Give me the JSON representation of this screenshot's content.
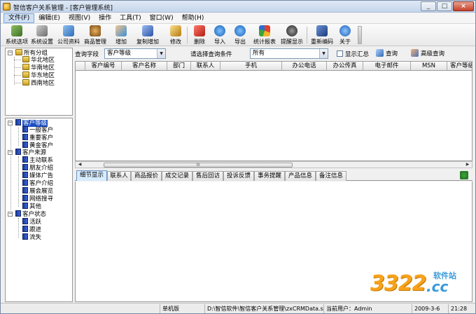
{
  "window": {
    "title": "智信客户关系管理 - [客户管理系统]",
    "controls": [
      "_",
      "□",
      "×"
    ]
  },
  "menu": [
    "文件(F)",
    "编辑(E)",
    "视图(V)",
    "操作",
    "工具(T)",
    "窗口(W)",
    "帮助(H)"
  ],
  "toolbar": [
    {
      "label": "系统选项",
      "icon": "settings-wrench-icon",
      "color": "#5a8a3c"
    },
    {
      "label": "系统设置",
      "icon": "tools-icon",
      "color": "#7a7a7a"
    },
    {
      "label": "公司资料",
      "icon": "company-icon",
      "color": "#3f7fc6"
    },
    {
      "label": "商品管理",
      "icon": "product-icon",
      "color": "#9a6a2a"
    },
    {
      "label": "增加",
      "icon": "add-user-icon",
      "color": "#3b8ed8"
    },
    {
      "label": "复制增加",
      "icon": "copy-add-icon",
      "color": "#3667b8"
    },
    {
      "label": "修改",
      "icon": "edit-icon",
      "color": "#c58a20"
    },
    {
      "label": "删除",
      "icon": "delete-icon",
      "color": "#d0302a"
    },
    {
      "label": "导入",
      "icon": "import-icon",
      "color": "#1f7bd8"
    },
    {
      "label": "导出",
      "icon": "export-icon",
      "color": "#1f7bd8"
    },
    {
      "label": "统计报表",
      "icon": "chart-icon",
      "color": "#d44a2a"
    },
    {
      "label": "提醒显示",
      "icon": "bell-icon",
      "color": "#444444"
    },
    {
      "label": "重新编码",
      "icon": "recode-icon",
      "color": "#2d5aa8"
    },
    {
      "label": "关于",
      "icon": "about-icon",
      "color": "#2a73c8"
    }
  ],
  "tree_region": {
    "root": "所有分组",
    "children": [
      "华北地区",
      "华南地区",
      "华东地区",
      "西南地区"
    ]
  },
  "tree_category": [
    {
      "label": "客户等级",
      "selected": true,
      "children": [
        "一般客户",
        "重要客户",
        "黄金客户"
      ]
    },
    {
      "label": "客户来源",
      "selected": false,
      "children": [
        "主动联系",
        "朋友介绍",
        "媒体广告",
        "客户介绍",
        "展会展览",
        "网络搜寻",
        "其他"
      ]
    },
    {
      "label": "客户状态",
      "selected": false,
      "children": [
        "活跃",
        "跟进",
        "流失"
      ]
    }
  ],
  "filter": {
    "field_label": "查询字段",
    "field_value": "客户等级",
    "condition_label": "请选择查询条件",
    "condition_value": "所有",
    "summary_label": "显示汇总",
    "query_label": "查询",
    "advanced_label": "高级查询"
  },
  "grid": {
    "columns": [
      "客户编号",
      "客户名称",
      "部门",
      "联系人",
      "手机",
      "办公电话",
      "办公传真",
      "电子邮件",
      "MSN",
      "客户等级"
    ],
    "scroll_thumb": "III"
  },
  "tabs": [
    "细节显示",
    "联系人",
    "商品报价",
    "成交记录",
    "售后回访",
    "投诉反馈",
    "事务提醒",
    "产品信息",
    "备注信息"
  ],
  "status": {
    "cell1": "",
    "edition": "单机版",
    "path": "D:\\智信软件\\智信客户关系管理\\zxCRMData.sys",
    "user": "当前用户：Admin",
    "date": "2009-3-6",
    "time": "21:28"
  },
  "watermark": {
    "number": "3322",
    "suffix": ".cc",
    "site": "软件站"
  }
}
